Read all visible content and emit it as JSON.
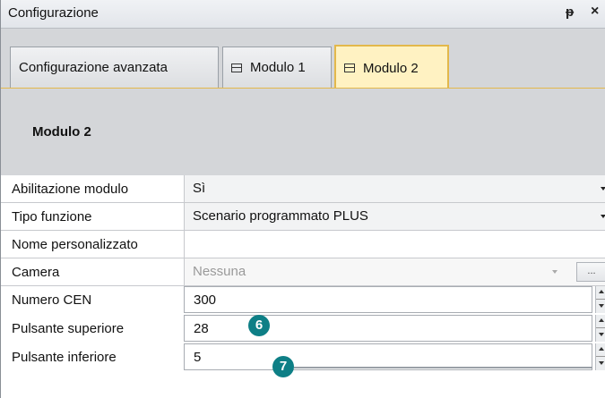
{
  "window": {
    "title": "Configurazione",
    "pin_glyph": "ᵽ",
    "close_glyph": "×"
  },
  "tabs": [
    {
      "label": "Configurazione avanzata",
      "active": false,
      "icon": null
    },
    {
      "label": "Modulo 1",
      "active": false,
      "icon": "module-icon"
    },
    {
      "label": "Modulo 2",
      "active": true,
      "icon": "module-icon"
    }
  ],
  "header": {
    "title": "Modulo 2"
  },
  "properties": [
    {
      "label": "Abilitazione modulo",
      "value": "Sì",
      "type": "combo"
    },
    {
      "label": "Tipo funzione",
      "value": "Scenario programmato PLUS",
      "type": "combo"
    },
    {
      "label": "Nome personalizzato",
      "value": "",
      "type": "text"
    },
    {
      "label": "Camera",
      "value": "Nessuna",
      "type": "combo-disabled",
      "button": "..."
    },
    {
      "label": "Numero CEN",
      "value": "300",
      "type": "number"
    },
    {
      "label": "Pulsante superiore",
      "value": "28",
      "type": "number"
    },
    {
      "label": "Pulsante inferiore",
      "value": "5",
      "type": "number"
    }
  ],
  "callouts": [
    "6",
    "7"
  ],
  "colors": {
    "active_tab": "#fff2c2",
    "active_tab_border": "#e3b84b",
    "callout": "#0e7f86"
  }
}
